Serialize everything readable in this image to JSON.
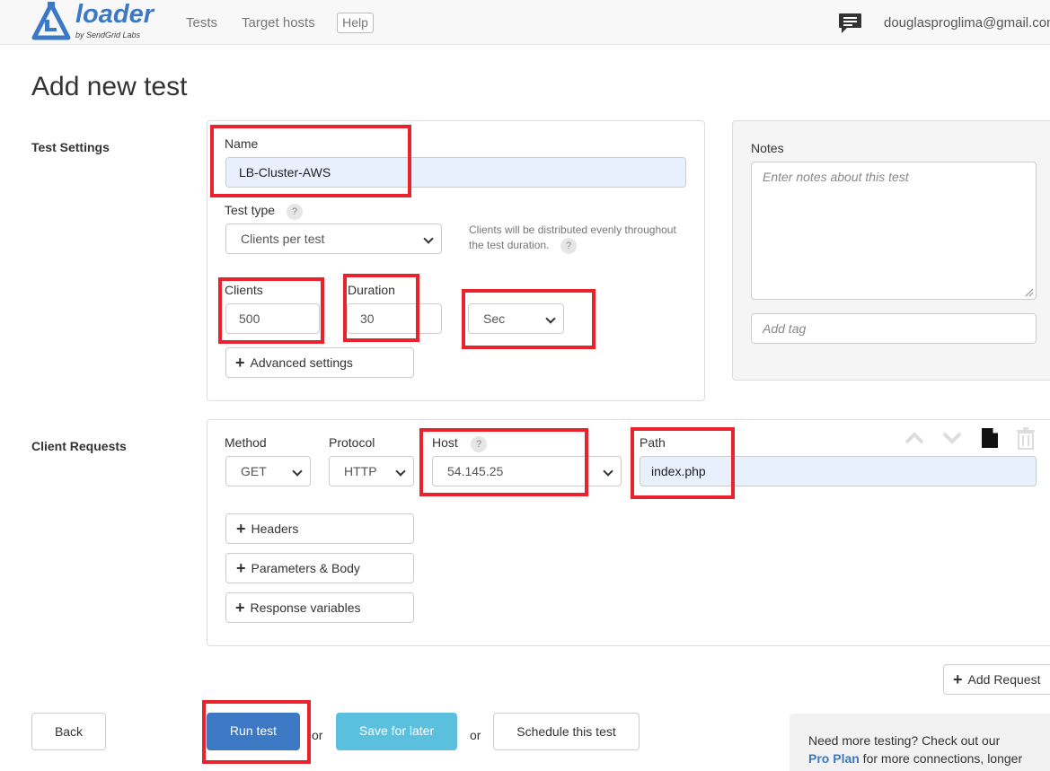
{
  "nav": {
    "logo_text": "loader",
    "logo_sub": "by SendGrid Labs",
    "links": [
      "Tests",
      "Target hosts"
    ],
    "help": "Help",
    "email": "douglasproglima@gmail.com"
  },
  "page_title": "Add new test",
  "test_settings": {
    "section_label": "Test Settings",
    "name_label": "Name",
    "name_value": "LB-Cluster-AWS",
    "test_type_label": "Test type",
    "test_type_value": "Clients per test",
    "hint": "Clients will be distributed evenly throughout the test duration.",
    "clients_label": "Clients",
    "clients_value": "500",
    "duration_label": "Duration",
    "duration_value": "30",
    "duration_unit": "Sec",
    "advanced": "Advanced settings",
    "help_glyph": "?"
  },
  "notes": {
    "label": "Notes",
    "placeholder": "Enter notes about this test",
    "tag_placeholder": "Add tag"
  },
  "client_requests": {
    "section_label": "Client Requests",
    "method_label": "Method",
    "method_value": "GET",
    "protocol_label": "Protocol",
    "protocol_value": "HTTP",
    "host_label": "Host",
    "host_value": "54.145.25",
    "path_label": "Path",
    "path_value": "index.php",
    "headers": "Headers",
    "params": "Parameters & Body",
    "response_vars": "Response variables",
    "add_request": "Add Request"
  },
  "actions": {
    "back": "Back",
    "run": "Run test",
    "or": "or",
    "save": "Save for later",
    "schedule": "Schedule this test"
  },
  "promo": {
    "line1": "Need more testing? Check out our",
    "plan": "Pro Plan",
    "line2": " for more connections, longer"
  },
  "colors": {
    "primary": "#3c78c3",
    "info": "#5bc0de",
    "annotation": "#e8232b"
  }
}
